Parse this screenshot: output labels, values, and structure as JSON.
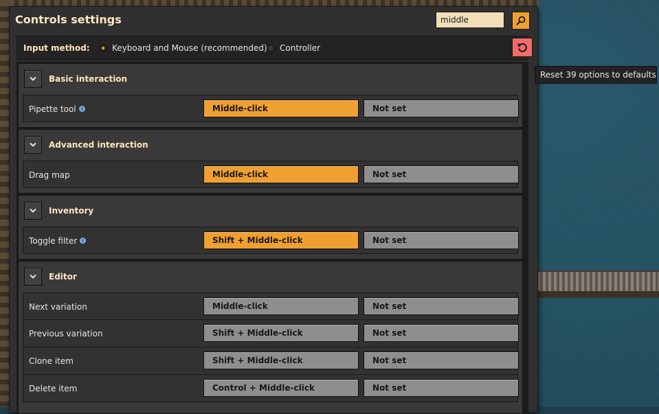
{
  "window": {
    "title": "Controls settings",
    "search": {
      "value": "middle",
      "placeholder": ""
    }
  },
  "input_method": {
    "label": "Input method:",
    "options": [
      {
        "label": "Keyboard and Mouse (recommended)",
        "selected": true
      },
      {
        "label": "Controller",
        "selected": false
      }
    ]
  },
  "tooltip": {
    "reset": "Reset 39 options to defaults"
  },
  "sections": [
    {
      "title": "Basic interaction",
      "rows": [
        {
          "label": "Pipette tool",
          "has_info": true,
          "primary": "Middle-click",
          "secondary": "Not set",
          "highlighted": true
        }
      ]
    },
    {
      "title": "Advanced interaction",
      "rows": [
        {
          "label": "Drag map",
          "has_info": false,
          "primary": "Middle-click",
          "secondary": "Not set",
          "highlighted": true
        }
      ]
    },
    {
      "title": "Inventory",
      "rows": [
        {
          "label": "Toggle filter",
          "has_info": true,
          "primary": "Shift + Middle-click",
          "secondary": "Not set",
          "highlighted": true
        }
      ]
    },
    {
      "title": "Editor",
      "rows": [
        {
          "label": "Next variation",
          "has_info": false,
          "primary": "Middle-click",
          "secondary": "Not set",
          "highlighted": false
        },
        {
          "label": "Previous variation",
          "has_info": false,
          "primary": "Shift + Middle-click",
          "secondary": "Not set",
          "highlighted": false
        },
        {
          "label": "Clone item",
          "has_info": false,
          "primary": "Shift + Middle-click",
          "secondary": "Not set",
          "highlighted": false
        },
        {
          "label": "Delete item",
          "has_info": false,
          "primary": "Control + Middle-click",
          "secondary": "Not set",
          "highlighted": false
        }
      ]
    }
  ],
  "colors": {
    "accent": "#f0a030",
    "reset": "#f26a6a",
    "heading": "#ffe6c0",
    "panel": "#313031"
  }
}
